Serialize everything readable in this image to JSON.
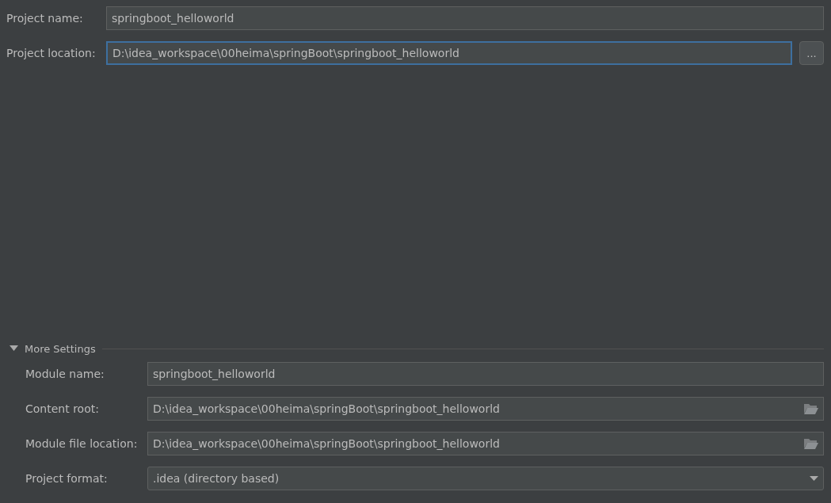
{
  "project_name": {
    "label": "Project name:",
    "value": "springboot_helloworld",
    "focused": false
  },
  "project_location": {
    "label": "Project location:",
    "value": "D:\\idea_workspace\\00heima\\springBoot\\springboot_helloworld",
    "focused": true,
    "browse_button": "..."
  },
  "more_settings": {
    "label": "More Settings",
    "expanded": true,
    "fields": [
      {
        "kind": "text",
        "label": "Module name:",
        "value": "springboot_helloworld"
      },
      {
        "kind": "path",
        "label": "Content root:",
        "value": "D:\\idea_workspace\\00heima\\springBoot\\springboot_helloworld"
      },
      {
        "kind": "path",
        "label": "Module file location:",
        "value": "D:\\idea_workspace\\00heima\\springBoot\\springboot_helloworld"
      },
      {
        "kind": "dropdown",
        "label": "Project format:",
        "value": ".idea (directory based)"
      }
    ]
  }
}
